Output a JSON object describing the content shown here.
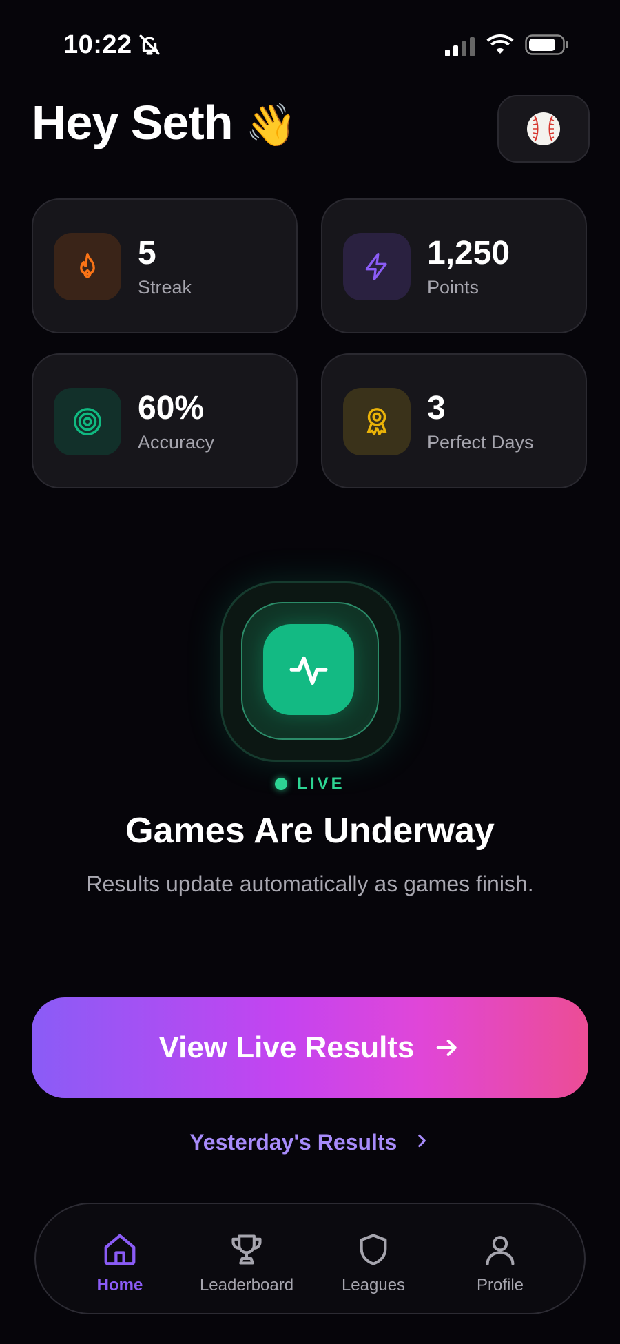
{
  "status_bar": {
    "time": "10:22"
  },
  "header": {
    "greeting": "Hey Seth",
    "wave_emoji": "👋",
    "avatar_emoji": "⚾"
  },
  "stats": [
    {
      "value": "5",
      "label": "Streak",
      "icon": "flame-icon",
      "color": "#f97316"
    },
    {
      "value": "1,250",
      "label": "Points",
      "icon": "lightning-icon",
      "color": "#8b5cf6"
    },
    {
      "value": "60%",
      "label": "Accuracy",
      "icon": "target-icon",
      "color": "#10b981"
    },
    {
      "value": "3",
      "label": "Perfect Days",
      "icon": "award-ribbon-icon",
      "color": "#eab308"
    }
  ],
  "live": {
    "badge": "LIVE",
    "title": "Games Are Underway",
    "subtitle": "Results update automatically as games finish."
  },
  "cta": {
    "label": "View Live Results"
  },
  "secondary_link": {
    "label": "Yesterday's Results"
  },
  "tabs": [
    {
      "label": "Home",
      "icon": "home-icon",
      "active": true
    },
    {
      "label": "Leaderboard",
      "icon": "trophy-icon",
      "active": false
    },
    {
      "label": "Leagues",
      "icon": "shield-icon",
      "active": false
    },
    {
      "label": "Profile",
      "icon": "person-icon",
      "active": false
    }
  ],
  "colors": {
    "background": "#06050a",
    "accent_purple": "#8b5cf6",
    "live_green": "#2dd493",
    "gradient_start": "#8a5cf6",
    "gradient_end": "#ec4d95"
  }
}
